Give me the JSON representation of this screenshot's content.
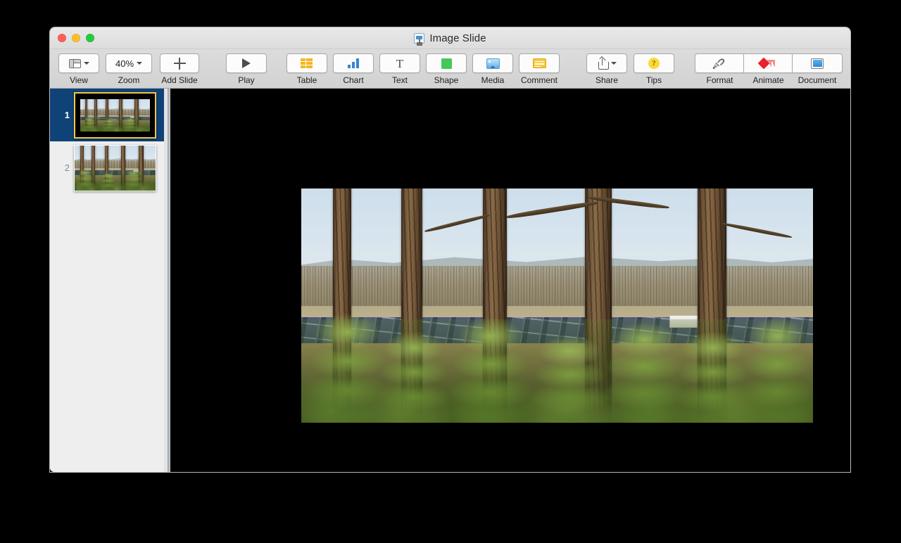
{
  "window": {
    "title": "Image Slide",
    "doc_icon": "keynote-document-icon",
    "traffic_lights": [
      "close",
      "minimize",
      "zoom"
    ]
  },
  "toolbar": {
    "items": [
      {
        "label": "View",
        "icon": "view-layout-icon",
        "has_chevron": true
      },
      {
        "label": "Zoom",
        "icon": "zoom-value",
        "value": "40%",
        "has_chevron": true
      },
      {
        "label": "Add Slide",
        "icon": "plus-icon",
        "has_chevron": false
      },
      {
        "label": "Play",
        "icon": "play-triangle-icon",
        "has_chevron": false
      },
      {
        "label": "Table",
        "icon": "table-grid-icon",
        "has_chevron": false
      },
      {
        "label": "Chart",
        "icon": "bar-chart-icon",
        "has_chevron": false
      },
      {
        "label": "Text",
        "icon": "text-t-icon",
        "has_chevron": false
      },
      {
        "label": "Shape",
        "icon": "green-square-icon",
        "has_chevron": false
      },
      {
        "label": "Media",
        "icon": "photo-icon",
        "has_chevron": false
      },
      {
        "label": "Comment",
        "icon": "comment-note-icon",
        "has_chevron": false
      },
      {
        "label": "Share",
        "icon": "share-upload-icon",
        "has_chevron": true
      },
      {
        "label": "Tips",
        "icon": "question-mark-icon",
        "has_chevron": false
      }
    ],
    "inspector_segment": [
      {
        "label": "Format",
        "icon": "paintbrush-icon"
      },
      {
        "label": "Animate",
        "icon": "red-diamond-icon"
      },
      {
        "label": "Document",
        "icon": "document-panel-icon"
      }
    ],
    "colors": {
      "table_icon": "#f6b521",
      "chart_icon": "#3b82d6",
      "shape_icon": "#45c85a",
      "comment_icon": "#f8c93c",
      "tips_icon": "#fdd835",
      "animate_icon": "#e8242a",
      "document_icon": "#2e87d6"
    }
  },
  "navigator": {
    "slides": [
      {
        "number": "1",
        "selected": true,
        "layout": "letterboxed-photo",
        "selection_color": "#f2c744"
      },
      {
        "number": "2",
        "selected": false,
        "layout": "full-bleed-photo"
      }
    ]
  },
  "canvas": {
    "background_color": "#000000",
    "slide": {
      "background_color": "#000000",
      "image": {
        "name": "pine-trees-solar-farm-photo",
        "description": "Pine tree trunks in foreground with young pine saplings, overlooking a large solar panel array and wooded hills under a pale blue sky",
        "alt": "Solar farm seen through pine forest"
      }
    }
  }
}
